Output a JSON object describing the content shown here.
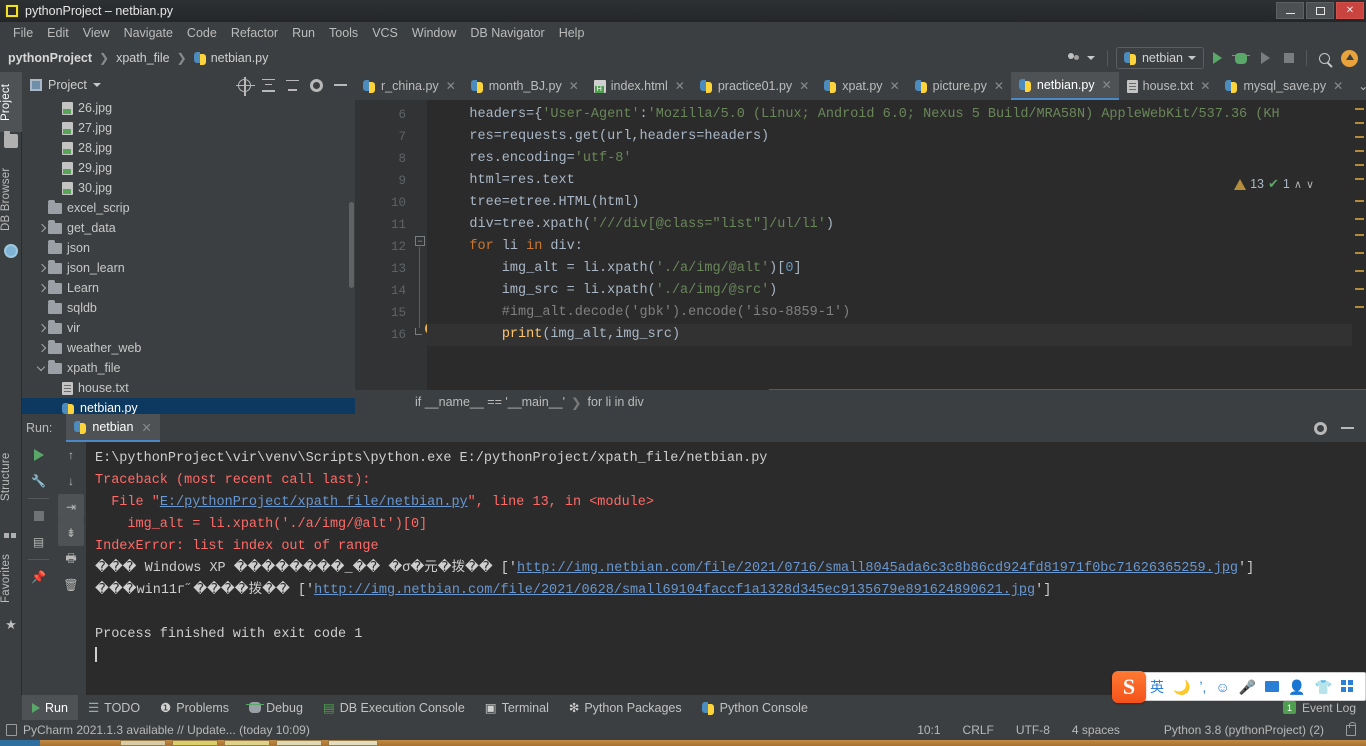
{
  "window": {
    "title": "pythonProject – netbian.py",
    "app_icon": "pycharm-icon",
    "minimize": "–",
    "maximize": "▢",
    "close": "✕"
  },
  "menubar": [
    {
      "label": "File"
    },
    {
      "label": "Edit"
    },
    {
      "label": "View"
    },
    {
      "label": "Navigate"
    },
    {
      "label": "Code"
    },
    {
      "label": "Refactor"
    },
    {
      "label": "Run"
    },
    {
      "label": "Tools"
    },
    {
      "label": "VCS"
    },
    {
      "label": "Window"
    },
    {
      "label": "DB Navigator"
    },
    {
      "label": "Help"
    }
  ],
  "navbar": {
    "crumbs": [
      "pythonProject",
      "xpath_file",
      "netbian.py"
    ],
    "run_config": "netbian",
    "icons": [
      "people-icon",
      "run-icon",
      "debug-icon",
      "run-coverage-icon",
      "stop-icon",
      "search-icon",
      "update-icon"
    ]
  },
  "left_strip": {
    "tabs": [
      {
        "label": "Project",
        "icon": "folder-icon",
        "active": true
      },
      {
        "label": "DB Browser",
        "icon": "database-icon",
        "active": false
      },
      {
        "label": "Structure",
        "icon": "structure-icon",
        "active": false
      },
      {
        "label": "Favorites",
        "icon": "star-icon",
        "active": false
      }
    ]
  },
  "project_panel": {
    "title": "Project",
    "tools": [
      "target-icon",
      "collapse-all-icon",
      "expand-icon",
      "gear-icon",
      "minimize-icon"
    ],
    "tree": [
      {
        "label": "26.jpg",
        "type": "image",
        "indent": 3,
        "arrow": "none",
        "selected": false
      },
      {
        "label": "27.jpg",
        "type": "image",
        "indent": 3,
        "arrow": "none",
        "selected": false
      },
      {
        "label": "28.jpg",
        "type": "image",
        "indent": 3,
        "arrow": "none",
        "selected": false
      },
      {
        "label": "29.jpg",
        "type": "image",
        "indent": 3,
        "arrow": "none",
        "selected": false
      },
      {
        "label": "30.jpg",
        "type": "image",
        "indent": 3,
        "arrow": "none",
        "selected": false
      },
      {
        "label": "excel_scrip",
        "type": "folder",
        "indent": 2,
        "arrow": "none",
        "selected": false
      },
      {
        "label": "get_data",
        "type": "folder",
        "indent": 2,
        "arrow": "right",
        "selected": false
      },
      {
        "label": "json",
        "type": "folder",
        "indent": 2,
        "arrow": "none",
        "selected": false
      },
      {
        "label": "json_learn",
        "type": "folder",
        "indent": 2,
        "arrow": "right",
        "selected": false
      },
      {
        "label": "Learn",
        "type": "folder",
        "indent": 2,
        "arrow": "right",
        "selected": false
      },
      {
        "label": "sqldb",
        "type": "folder",
        "indent": 2,
        "arrow": "none",
        "selected": false
      },
      {
        "label": "vir",
        "type": "folder",
        "indent": 2,
        "arrow": "right",
        "selected": false
      },
      {
        "label": "weather_web",
        "type": "folder",
        "indent": 2,
        "arrow": "right",
        "selected": false
      },
      {
        "label": "xpath_file",
        "type": "folder",
        "indent": 2,
        "arrow": "down",
        "selected": false
      },
      {
        "label": "house.txt",
        "type": "text",
        "indent": 3,
        "arrow": "none",
        "selected": false
      },
      {
        "label": "netbian.py",
        "type": "python",
        "indent": 3,
        "arrow": "none",
        "selected": true
      }
    ]
  },
  "editor": {
    "tabs": [
      {
        "label": "r_china.py",
        "icon": "python-icon",
        "active": false
      },
      {
        "label": "month_BJ.py",
        "icon": "python-icon",
        "active": false
      },
      {
        "label": "index.html",
        "icon": "html-icon",
        "active": false
      },
      {
        "label": "practice01.py",
        "icon": "python-icon",
        "active": false
      },
      {
        "label": "xpat.py",
        "icon": "python-icon",
        "active": false
      },
      {
        "label": "picture.py",
        "icon": "python-icon",
        "active": false
      },
      {
        "label": "netbian.py",
        "icon": "python-icon",
        "active": true
      },
      {
        "label": "house.txt",
        "icon": "text-icon",
        "active": false
      },
      {
        "label": "mysql_save.py",
        "icon": "python-icon",
        "active": false
      }
    ],
    "line_numbers": [
      "6",
      "7",
      "8",
      "9",
      "10",
      "11",
      "12",
      "13",
      "14",
      "15",
      "16"
    ],
    "lines": [
      {
        "n": "6",
        "text": "    headers={'User-Agent':'Mozilla/5.0 (Linux; Android 6.0; Nexus 5 Build/MRA58N) AppleWebKit/537.36 (KH"
      },
      {
        "n": "7",
        "text": "    res=requests.get(url,headers=headers)"
      },
      {
        "n": "8",
        "text": "    res.encoding='utf-8'"
      },
      {
        "n": "9",
        "text": "    html=res.text"
      },
      {
        "n": "10",
        "text": "    tree=etree.HTML(html)"
      },
      {
        "n": "11",
        "text": "    div=tree.xpath('///div[@class=\"list\"]/ul/li')"
      },
      {
        "n": "12",
        "text": "    for li in div:"
      },
      {
        "n": "13",
        "text": "        img_alt = li.xpath('./a/img/@alt')[0]"
      },
      {
        "n": "14",
        "text": "        img_src = li.xpath('./a/img/@src')"
      },
      {
        "n": "15",
        "text": "        #img_alt.decode('gbk').encode('iso-8859-1')"
      },
      {
        "n": "16",
        "text": "        print(img_alt,img_src)"
      }
    ],
    "inspection": {
      "warnings": "13",
      "ok": "1",
      "warning_icon": "warning-triangle-icon",
      "ok_icon": "check-icon"
    },
    "breadcrumb": [
      "if __name__ == '__main__'",
      "for li in div"
    ]
  },
  "run_window": {
    "label": "Run:",
    "tab": "netbian",
    "tab_icon": "python-icon",
    "toolbar_left": [
      "rerun-icon",
      "wrench-icon",
      "stop-icon",
      "layout-icon",
      "pin-icon"
    ],
    "toolbar_left2": [
      "up-arrow-icon",
      "down-arrow-icon",
      "soft-wrap-icon",
      "scroll-to-end-icon",
      "print-icon",
      "trash-icon"
    ],
    "toolbar_right": [
      "gear-icon",
      "minimize-icon"
    ],
    "console_lines": [
      {
        "type": "plain",
        "text": "E:\\pythonProject\\vir\\venv\\Scripts\\python.exe E:/pythonProject/xpath_file/netbian.py"
      },
      {
        "type": "error",
        "text": "Traceback (most recent call last):"
      },
      {
        "type": "error_link",
        "prefix": "  File \"",
        "link": "E:/pythonProject/xpath_file/netbian.py",
        "suffix": "\", line 13, in <module>"
      },
      {
        "type": "error",
        "text": "    img_alt = li.xpath('./a/img/@alt')[0]"
      },
      {
        "type": "error",
        "text": "IndexError: list index out of range"
      },
      {
        "type": "output_link",
        "prefix": "��� Windows XP ��������_�� �σ�元�拨�� ['",
        "link": "http://img.netbian.com/file/2021/0716/small8045ada6c3c8b86cd924fd81971f0bc71626365259.jpg",
        "suffix": "']"
      },
      {
        "type": "output_link",
        "prefix": "���win11г˝����拨�� ['",
        "link": "http://img.netbian.com/file/2021/0628/small69104faccf1a1328d345ec9135679e891624890621.jpg",
        "suffix": "']"
      },
      {
        "type": "blank",
        "text": ""
      },
      {
        "type": "plain",
        "text": "Process finished with exit code 1"
      },
      {
        "type": "caret",
        "text": ""
      }
    ]
  },
  "bottom_bar": {
    "items": [
      {
        "label": "Run",
        "icon": "run-icon",
        "active": true
      },
      {
        "label": "TODO",
        "icon": "todo-icon",
        "active": false
      },
      {
        "label": "Problems",
        "icon": "problems-icon",
        "active": false
      },
      {
        "label": "Debug",
        "icon": "debug-icon",
        "active": false
      },
      {
        "label": "DB Execution Console",
        "icon": "db-console-icon",
        "active": false
      },
      {
        "label": "Terminal",
        "icon": "terminal-icon",
        "active": false
      },
      {
        "label": "Python Packages",
        "icon": "packages-icon",
        "active": false
      },
      {
        "label": "Python Console",
        "icon": "python-console-icon",
        "active": false
      }
    ],
    "event_log": {
      "label": "Event Log",
      "badge": "1"
    }
  },
  "status_bar": {
    "message": "PyCharm 2021.1.3 available // Update... (today 10:09)",
    "caret_position": "10:1",
    "line_separator": "CRLF",
    "encoding": "UTF-8",
    "indent": "4 spaces",
    "interpreter": "Python 3.8 (pythonProject) (2)",
    "lock_icon": "lock-icon"
  },
  "ime_toolbar": {
    "logo": "S",
    "items": [
      "英",
      "moon-icon",
      "comma-icon",
      "smiley-icon",
      "mic-icon",
      "keyboard-icon",
      "user-icon",
      "shirt-icon",
      "grid-icon"
    ]
  },
  "colors": {
    "accent": "#4a88c7",
    "bg": "#3c3f41",
    "editor_bg": "#2b2b2b",
    "error": "#ff6b68",
    "link": "#6897d1",
    "string": "#6a8759",
    "keyword": "#cc7832",
    "selection": "#0d385f"
  }
}
